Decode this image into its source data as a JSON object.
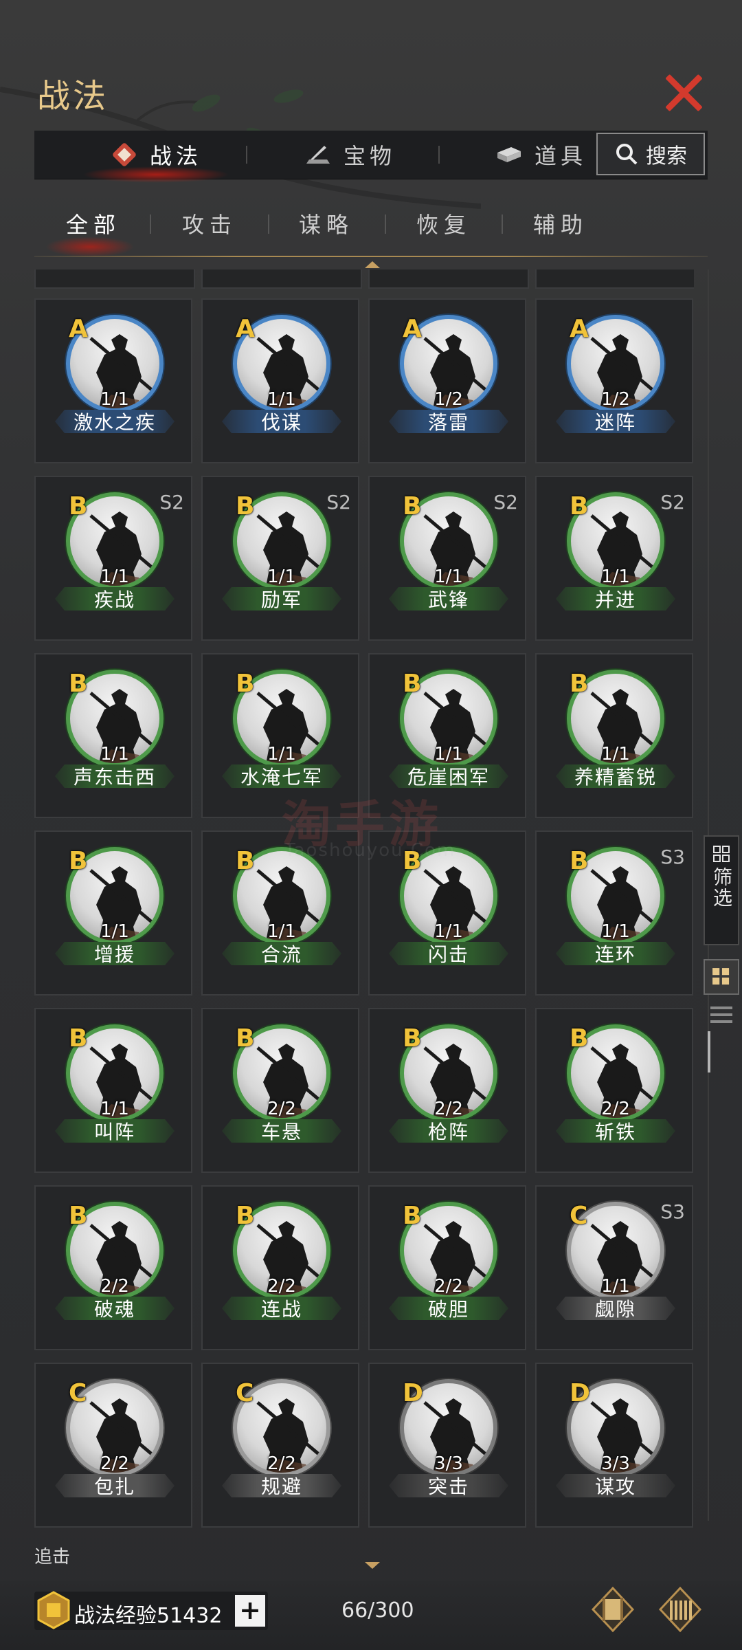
{
  "window": {
    "title": "战法"
  },
  "main_tabs": [
    {
      "label": "战法",
      "icon": "tactics-icon",
      "active": true
    },
    {
      "label": "宝物",
      "icon": "treasure-icon",
      "active": false
    },
    {
      "label": "道具",
      "icon": "item-icon",
      "active": false
    }
  ],
  "search": {
    "label": "搜索"
  },
  "sub_tabs": [
    {
      "label": "全部",
      "active": true
    },
    {
      "label": "攻击",
      "active": false
    },
    {
      "label": "谋略",
      "active": false
    },
    {
      "label": "恢复",
      "active": false
    },
    {
      "label": "辅助",
      "active": false
    }
  ],
  "tactics": [
    {
      "grade": "A",
      "name": "激水之疾",
      "count": "1/1",
      "season": ""
    },
    {
      "grade": "A",
      "name": "伐谋",
      "count": "1/1",
      "season": ""
    },
    {
      "grade": "A",
      "name": "落雷",
      "count": "1/2",
      "season": ""
    },
    {
      "grade": "A",
      "name": "迷阵",
      "count": "1/2",
      "season": ""
    },
    {
      "grade": "B",
      "name": "疾战",
      "count": "1/1",
      "season": "S2"
    },
    {
      "grade": "B",
      "name": "励军",
      "count": "1/1",
      "season": "S2"
    },
    {
      "grade": "B",
      "name": "武锋",
      "count": "1/1",
      "season": "S2"
    },
    {
      "grade": "B",
      "name": "并进",
      "count": "1/1",
      "season": "S2"
    },
    {
      "grade": "B",
      "name": "声东击西",
      "count": "1/1",
      "season": ""
    },
    {
      "grade": "B",
      "name": "水淹七军",
      "count": "1/1",
      "season": ""
    },
    {
      "grade": "B",
      "name": "危崖困军",
      "count": "1/1",
      "season": ""
    },
    {
      "grade": "B",
      "name": "养精蓄锐",
      "count": "1/1",
      "season": ""
    },
    {
      "grade": "B",
      "name": "增援",
      "count": "1/1",
      "season": ""
    },
    {
      "grade": "B",
      "name": "合流",
      "count": "1/1",
      "season": ""
    },
    {
      "grade": "B",
      "name": "闪击",
      "count": "1/1",
      "season": ""
    },
    {
      "grade": "B",
      "name": "连环",
      "count": "1/1",
      "season": "S3"
    },
    {
      "grade": "B",
      "name": "叫阵",
      "count": "1/1",
      "season": ""
    },
    {
      "grade": "B",
      "name": "车悬",
      "count": "2/2",
      "season": ""
    },
    {
      "grade": "B",
      "name": "枪阵",
      "count": "2/2",
      "season": ""
    },
    {
      "grade": "B",
      "name": "斩铁",
      "count": "2/2",
      "season": ""
    },
    {
      "grade": "B",
      "name": "破魂",
      "count": "2/2",
      "season": ""
    },
    {
      "grade": "B",
      "name": "连战",
      "count": "2/2",
      "season": ""
    },
    {
      "grade": "B",
      "name": "破胆",
      "count": "2/2",
      "season": ""
    },
    {
      "grade": "C",
      "name": "觑隙",
      "count": "1/1",
      "season": "S3"
    },
    {
      "grade": "C",
      "name": "包扎",
      "count": "2/2",
      "season": ""
    },
    {
      "grade": "C",
      "name": "规避",
      "count": "2/2",
      "season": ""
    },
    {
      "grade": "D",
      "name": "突击",
      "count": "3/3",
      "season": ""
    },
    {
      "grade": "D",
      "name": "谋攻",
      "count": "3/3",
      "season": ""
    }
  ],
  "watermark": {
    "main": "淘手游",
    "sub": "Taoshouyou.Com"
  },
  "side": {
    "filter_label": "筛选"
  },
  "bottom": {
    "next_label": "追击"
  },
  "footer": {
    "exp_label": "战法经验51432",
    "plus": "+",
    "capacity": "66/300"
  },
  "colors": {
    "accent_red": "#d43a2d",
    "title_gold": "#e8c98b",
    "grade_gold": "#f1c33a"
  }
}
